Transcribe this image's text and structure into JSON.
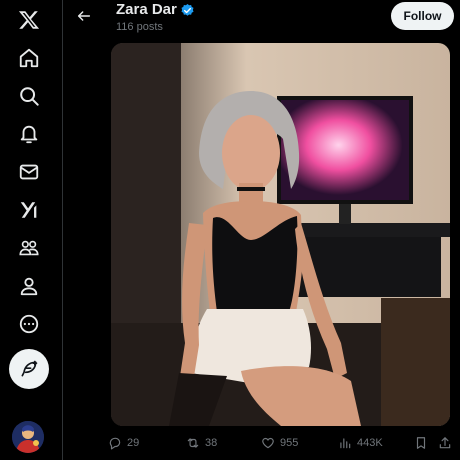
{
  "nav": {
    "items": [
      {
        "name": "x-logo-icon"
      },
      {
        "name": "home-icon"
      },
      {
        "name": "search-icon"
      },
      {
        "name": "notifications-bell-icon"
      },
      {
        "name": "messages-envelope-icon"
      },
      {
        "name": "grok-icon"
      },
      {
        "name": "communities-icon"
      },
      {
        "name": "profile-icon"
      },
      {
        "name": "more-circle-icon"
      }
    ],
    "compose_icon": "feather-compose-icon"
  },
  "header": {
    "name": "Zara Dar",
    "posts": "116 posts",
    "follow_label": "Follow",
    "verified_color": "#1d9bf0"
  },
  "actions": {
    "replies": "29",
    "reposts": "38",
    "likes": "955",
    "views": "443K"
  },
  "colors": {
    "background": "#000000",
    "text_primary": "#e7e9ea",
    "text_secondary": "#71767b",
    "button_bg": "#eff3f4"
  }
}
